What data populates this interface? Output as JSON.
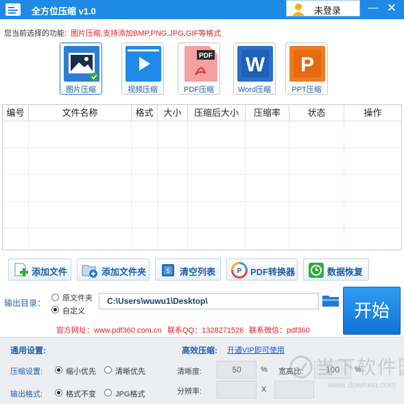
{
  "titlebar": {
    "title": "全方位压缩 v1.0",
    "login_label": "未登录",
    "minimize_glyph": "—",
    "close_glyph": "✕"
  },
  "function_line": {
    "label": "您当前选择的功能:",
    "description": "图片压缩,支持添加BMP,PNG,JPG,GIF等格式"
  },
  "tools": [
    {
      "label": "图片压缩",
      "icon": "image-icon",
      "active": true
    },
    {
      "label": "视频压缩",
      "icon": "video-icon",
      "active": false
    },
    {
      "label": "PDF压缩",
      "icon": "pdf-icon",
      "badge": "PDF",
      "active": false
    },
    {
      "label": "Word压缩",
      "icon": "word-icon",
      "badge": "W",
      "active": false
    },
    {
      "label": "PPT压缩",
      "icon": "ppt-icon",
      "badge": "P",
      "active": false
    }
  ],
  "table": {
    "columns": [
      "编号",
      "文件名称",
      "格式",
      "大小",
      "压缩后大小",
      "压缩率",
      "状态",
      "操作"
    ],
    "rows": []
  },
  "actions": {
    "add_file": "添加文件",
    "add_folder": "添加文件夹",
    "clear_list": "清空列表",
    "pdf_converter": "PDF转换器",
    "data_recovery": "数据恢复"
  },
  "output": {
    "label": "输出目录：",
    "option_original": "原文件夹",
    "option_custom": "自定义",
    "selected": "自定义",
    "path": "C:\\Users\\wuwu1\\Desktop\\",
    "start_label": "开始"
  },
  "contact": {
    "website": "官方网址：www.pdf360.com.cn",
    "qq": "联系QQ：1328271526",
    "wechat": "联系微信：pdf360"
  },
  "settings": {
    "general_title": "通用设置:",
    "efficient_title": "高效压缩:",
    "vip_link": "开通VIP即可使用",
    "compress_label": "压缩设置:",
    "compress_opt1": "缩小优先",
    "compress_opt2": "清晰优先",
    "compress_selected": "缩小优先",
    "format_label": "输出格式:",
    "format_opt1": "格式不变",
    "format_opt2": "JPG格式",
    "format_selected": "格式不变",
    "clarity_label": "清晰度:",
    "clarity_value": "50",
    "clarity_unit": "%",
    "ratio_label": "宽高比:",
    "ratio_value": "100",
    "ratio_unit": "%",
    "resolution_label": "分辨率:",
    "resolution_x": "",
    "resolution_sep": "X",
    "resolution_y": ""
  },
  "watermark": {
    "brand": "当下软件园",
    "url": "www.downxia.com"
  },
  "colors": {
    "titlebar": "#1e8ae6",
    "accent_text": "#1f5fa8",
    "alert_text": "#e02020",
    "start_button": "#1a84e4"
  }
}
